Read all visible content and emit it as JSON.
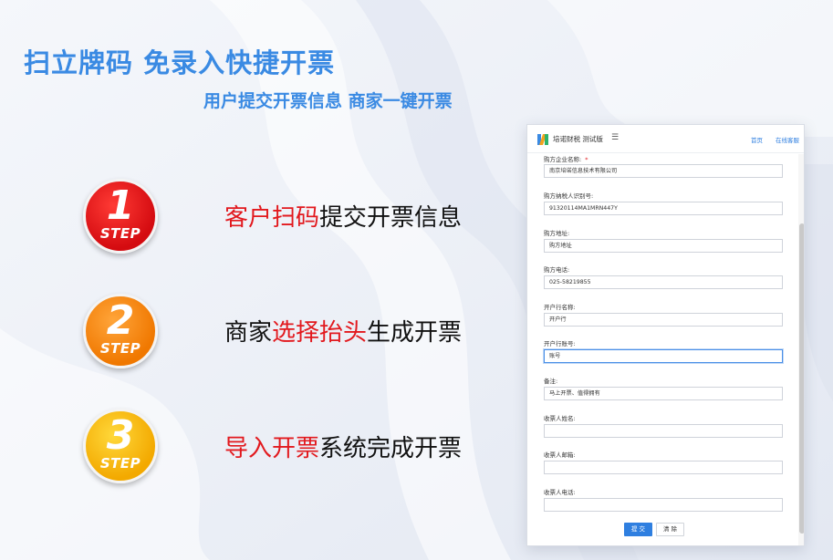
{
  "headline": "扫立牌码 免录入快捷开票",
  "subline": "用户提交开票信息 商家一键开票",
  "steps": [
    {
      "num": "1",
      "label": "STEP",
      "text_highlight": "客户扫码",
      "text_rest": "提交开票信息"
    },
    {
      "num": "2",
      "label": "STEP",
      "text_prefix": "商家",
      "text_highlight": "选择抬头",
      "text_rest": "生成开票"
    },
    {
      "num": "3",
      "label": "STEP",
      "text_highlight": "导入开票",
      "text_rest": "系统完成开票"
    }
  ],
  "phone": {
    "app_title": "培诺财税 测试版",
    "menu_icon": "menu-icon",
    "nav_home": "首页",
    "nav_consult": "在线客服",
    "required_mark": "*",
    "fields": [
      {
        "label": "购方企业名称:",
        "value": "南京培诺信息技术有限公司",
        "required": true
      },
      {
        "label": "购方纳税人识别号:",
        "value": "91320114MA1MRN447Y"
      },
      {
        "label": "购方地址:",
        "value": "购方地址"
      },
      {
        "label": "购方电话:",
        "value": "025-58219855"
      },
      {
        "label": "开户行名称:",
        "value": "开户行"
      },
      {
        "label": "开户行账号:",
        "value": "账号"
      },
      {
        "label": "备注:",
        "value": "马上开票、值得拥有"
      },
      {
        "label": "收票人姓名:",
        "value": ""
      },
      {
        "label": "收票人邮箱:",
        "value": ""
      },
      {
        "label": "收票人电话:",
        "value": ""
      }
    ],
    "submit_label": "提 交",
    "clear_label": "清 除"
  },
  "colors": {
    "title_blue": "#3a8ae3",
    "highlight_red": "#e2191e",
    "step1": "#d40b10",
    "step2": "#f07800",
    "step3": "#f3a900",
    "button_blue": "#2f7fe0"
  }
}
